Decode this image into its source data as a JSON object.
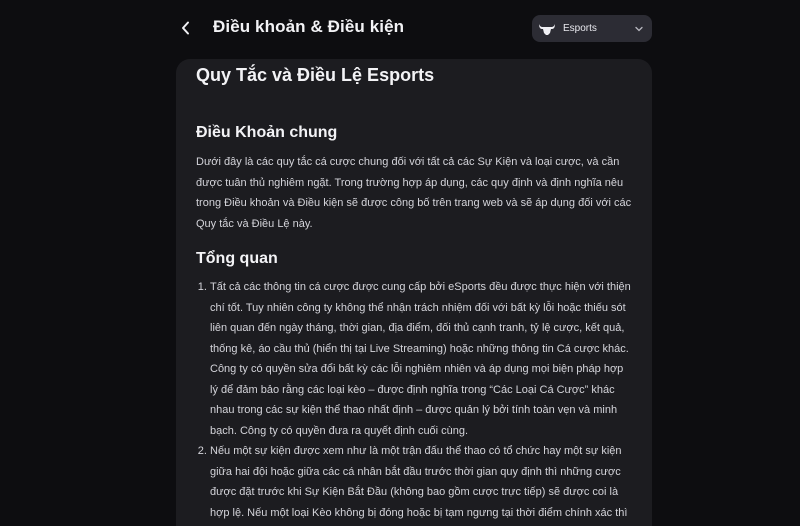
{
  "header": {
    "title": "Điều khoản & Điều kiện",
    "back_icon": "chevron-left-icon",
    "category_select": {
      "value": "Esports",
      "icon": "bull-icon",
      "dropdown_icon": "chevron-down-icon"
    }
  },
  "document": {
    "title": "Quy Tắc và Điều Lệ Esports",
    "sections": [
      {
        "heading": "Điều Khoản chung",
        "text": "Dưới đây là các quy tắc cá cược chung đối với tất cả các Sự Kiện và loại cược, và cần được tuân thủ nghiêm ngặt. Trong trường hợp áp dụng, các quy định và định nghĩa nêu trong Điều khoản và Điều kiện sẽ được công bố trên trang web và sẽ áp dụng đối với các Quy tắc và Điều Lệ này."
      },
      {
        "heading": "Tổng quan",
        "items": [
          "Tất cả các thông tin cá cược được cung cấp bởi eSports đều được thực hiện với thiện chí tốt. Tuy nhiên công ty không thể nhận trách nhiệm đối với bất kỳ lỗi hoặc thiếu sót liên quan đến ngày tháng, thời gian, địa điểm, đối thủ cạnh tranh, tỷ lệ cược, kết quả, thống kê, áo cầu thủ (hiển thị tại Live Streaming) hoặc những thông tin Cá cược khác. Công ty có quyền sửa đổi bất kỳ các lỗi nghiêm nhiên và áp dụng mọi biện pháp hợp lý để đảm bảo rằng các loại kèo – được định nghĩa trong “Các Loại Cá Cược” khác nhau trong các sự kiện thể thao nhất định – được quản lý bởi tính toàn vẹn và minh bạch. Công ty có quyền đưa ra quyết định cuối cùng.",
          "Nếu một sự kiện được xem như là một trận đấu thể thao có tổ chức hay một sự kiện giữa hai đội hoặc giữa các cá nhân bắt đầu trước thời gian quy định thì những cược được đặt trước khi Sự Kiện Bắt Đầu (không bao gồm cược trực tiếp) sẽ được coi là hợp lệ. Nếu một loại Kèo không bị đóng hoặc bị tạm ngưng tại thời điểm chính xác thì Công"
        ]
      }
    ]
  },
  "colors": {
    "background": "#0d0d10",
    "card": "#1c1c20",
    "select": "#2c2c34",
    "text": "#d4d4da"
  }
}
